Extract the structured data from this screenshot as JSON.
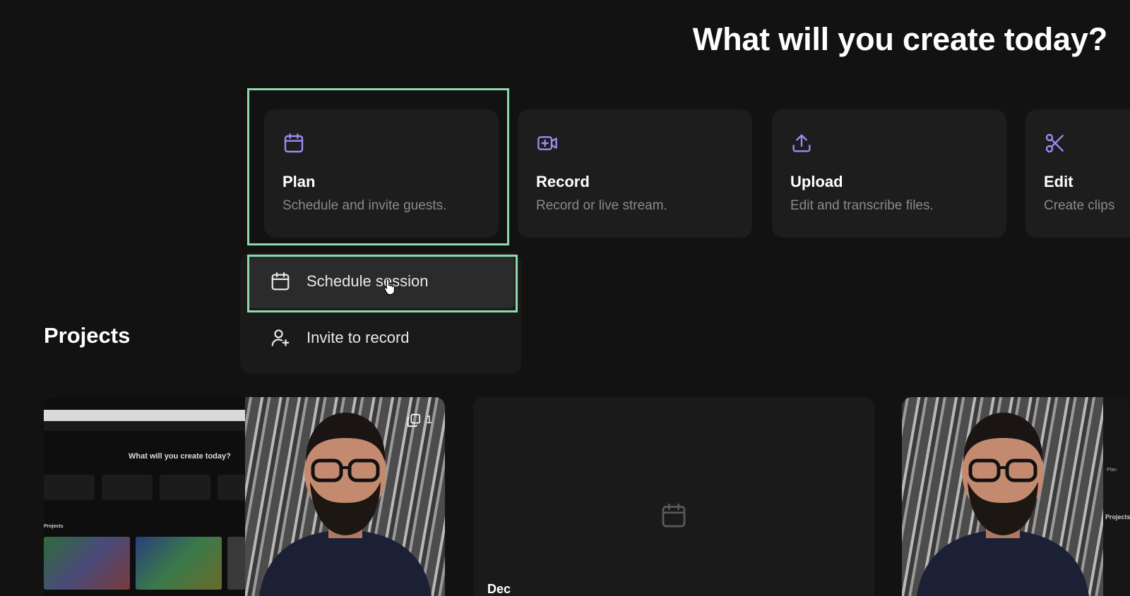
{
  "hero": {
    "title": "What will you create today?"
  },
  "cards": [
    {
      "icon": "calendar-icon",
      "title": "Plan",
      "description": "Schedule and invite guests."
    },
    {
      "icon": "video-plus-icon",
      "title": "Record",
      "description": "Record or live stream."
    },
    {
      "icon": "upload-icon",
      "title": "Upload",
      "description": "Edit and transcribe files."
    },
    {
      "icon": "scissors-icon",
      "title": "Edit",
      "description": "Create clips"
    }
  ],
  "plan_menu": {
    "items": [
      {
        "icon": "calendar-icon",
        "label": "Schedule session"
      },
      {
        "icon": "user-plus-icon",
        "label": "Invite to record"
      }
    ]
  },
  "projects": {
    "title": "Projects",
    "thumbnails": [
      {
        "mini_title": "What will you create today?",
        "mini_projects_label": "Projects",
        "clip_count": "1",
        "icon": "clips-icon"
      },
      {
        "icon": "calendar-icon",
        "date_label": "Dec"
      },
      {
        "side_label": "Projects",
        "side_plan": "Plan"
      }
    ]
  },
  "colors": {
    "accent": "#9b8cf0",
    "highlight": "#8fd9ae",
    "background": "#121212",
    "card": "#1d1d1d"
  }
}
